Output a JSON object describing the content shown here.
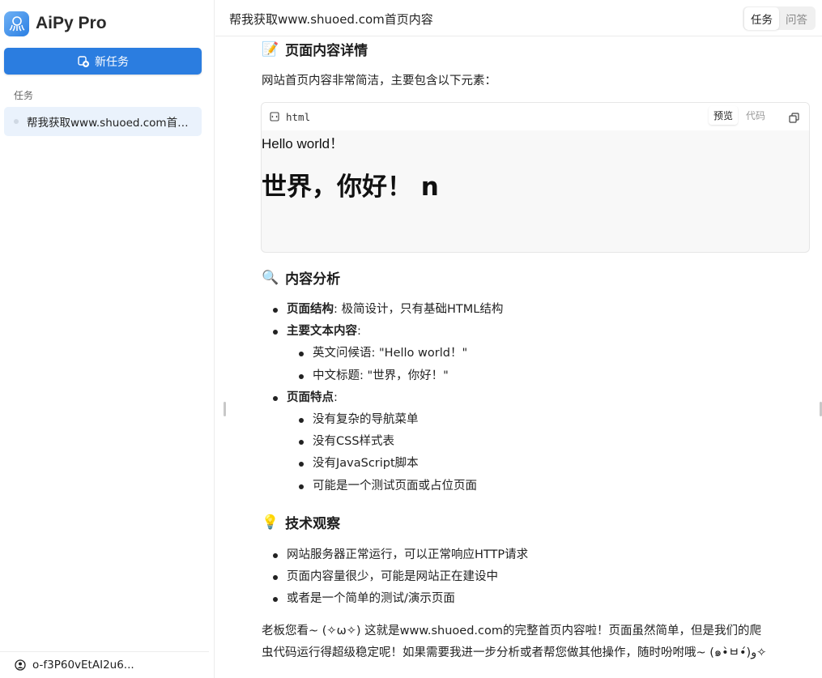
{
  "app": {
    "name": "AiPy Pro",
    "accent": "#2b7de0"
  },
  "sidebar": {
    "new_task_label": "新任务",
    "section_label": "任务",
    "tasks": [
      {
        "label": "帮我获取www.shuoed.com首页内容"
      }
    ],
    "footer_user": "o-f3P60vEtAI2u6..."
  },
  "header": {
    "title": "帮我获取www.shuoed.com首页内容",
    "tabs": [
      {
        "label": "任务",
        "active": true
      },
      {
        "label": "问答",
        "active": false
      }
    ]
  },
  "content": {
    "section1": {
      "icon": "📝",
      "title": "页面内容详情"
    },
    "intro": "网站首页内容非常简洁，主要包含以下元素：",
    "code_block": {
      "lang": "html",
      "tabs": [
        {
          "label": "预览",
          "active": true
        },
        {
          "label": "代码",
          "active": false
        }
      ],
      "preview_line": "Hello world！",
      "preview_heading": "世界，你好！ n"
    },
    "section2": {
      "icon": "🔍",
      "title": "内容分析"
    },
    "analysis": {
      "structure_label": "页面结构",
      "structure_text": ": 极简设计，只有基础HTML结构",
      "main_text_label": "主要文本内容",
      "main_text_suffix": ":",
      "sub1": "英文问候语: \"Hello world！\"",
      "sub2": "中文标题: \"世界，你好！\"",
      "features_label": "页面特点",
      "features_suffix": ":",
      "features": [
        "没有复杂的导航菜单",
        "没有CSS样式表",
        "没有JavaScript脚本",
        "可能是一个测试页面或占位页面"
      ]
    },
    "section3": {
      "icon": "💡",
      "title": "技术观察"
    },
    "observations": [
      "网站服务器正常运行，可以正常响应HTTP请求",
      "页面内容量很少，可能是网站正在建设中",
      "或者是一个简单的测试/演示页面"
    ],
    "closing_line1": "老板您看~ (✧ω✧) 这就是www.shuoed.com的完整首页内容啦！页面虽然简单，但是我们的爬",
    "closing_line2": "虫代码运行得超级稳定呢！如果需要我进一步分析或者帮您做其他操作，随时吩咐哦~ (๑•̀ㅂ•́)و✧"
  }
}
